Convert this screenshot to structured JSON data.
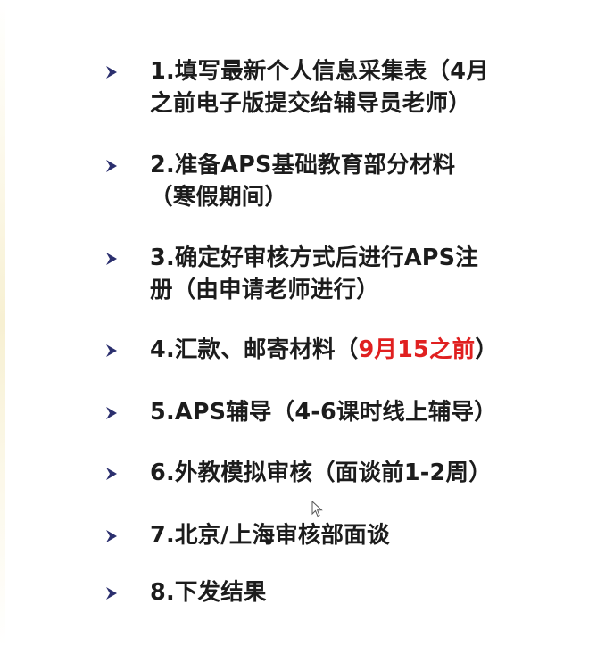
{
  "slide": {
    "items": [
      {
        "lines": [
          "1.填写最新个人信息采集表（4月",
          "之前电子版提交给辅导员老师）"
        ]
      },
      {
        "lines": [
          "2.准备APS基础教育部分材料",
          "（寒假期间）"
        ]
      },
      {
        "lines": [
          "3.确定好审核方式后进行APS注",
          "册（由申请老师进行）"
        ]
      },
      {
        "prefix": "4.汇款、邮寄材料（",
        "highlight": "9月15之前",
        "suffix": "）"
      },
      {
        "lines": [
          "5.APS辅导（4-6课时线上辅导）"
        ]
      },
      {
        "lines": [
          "6.外教模拟审核（面谈前1-2周）"
        ]
      },
      {
        "lines": [
          "7.北京/上海审核部面谈"
        ]
      },
      {
        "lines": [
          "8.下发结果"
        ]
      }
    ]
  },
  "colors": {
    "text": "#1c1c1c",
    "highlight": "#e02020",
    "bullet": "#2b2f6e"
  },
  "icons": {
    "bullet": "arrow-bullet-icon",
    "cursor": "mouse-pointer-icon"
  }
}
